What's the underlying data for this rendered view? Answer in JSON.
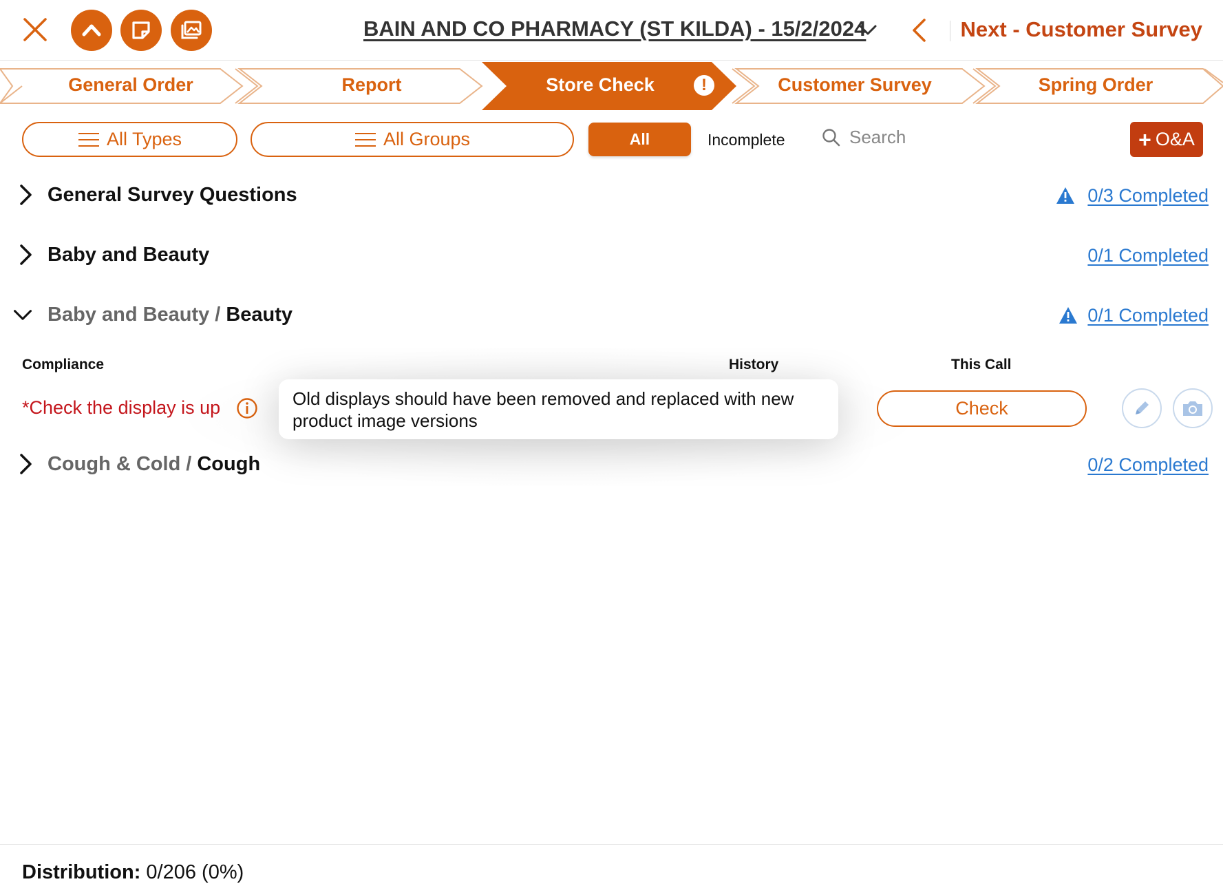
{
  "header": {
    "store_title": "BAIN AND CO PHARMACY (ST KILDA) - 15/2/2024",
    "next_label": "Next - Customer Survey",
    "icons": [
      "close-icon",
      "chevron-up-icon",
      "note-icon",
      "gallery-icon",
      "chevron-down-icon",
      "chevron-left-icon"
    ]
  },
  "steps": [
    {
      "label": "General Order",
      "active": false
    },
    {
      "label": "Report",
      "active": false
    },
    {
      "label": "Store Check",
      "active": true,
      "alert": "!"
    },
    {
      "label": "Customer Survey",
      "active": false
    },
    {
      "label": "Spring Order",
      "active": false
    }
  ],
  "filters": {
    "types": "All Types",
    "groups": "All Groups",
    "all": "All",
    "incomplete": "Incomplete",
    "search_placeholder": "Search",
    "qa_label": "O&A"
  },
  "sections": [
    {
      "title": "General Survey Questions",
      "completed": "0/3 Completed",
      "warning": true,
      "expanded": false
    },
    {
      "title": "Baby and Beauty",
      "completed": "0/1 Completed",
      "warning": false,
      "expanded": false
    },
    {
      "crumb": "Baby and Beauty",
      "separator": "/",
      "title": "Beauty",
      "completed": "0/1 Completed",
      "warning": true,
      "expanded": true
    },
    {
      "crumb": "Cough & Cold",
      "separator": "/",
      "title": "Cough",
      "completed": "0/2 Completed",
      "warning": false,
      "expanded": false
    }
  ],
  "compliance": {
    "col_compliance": "Compliance",
    "col_history": "History",
    "col_this_call": "This Call",
    "question": "*Check the display is up",
    "tooltip": "Old displays should have been removed and replaced with new product image versions",
    "check_label": "Check"
  },
  "footer": {
    "label": "Distribution:",
    "value": "0/206 (0%)"
  },
  "colors": {
    "accent": "#d9620f",
    "accent_dark": "#c23d10",
    "link": "#2a79d0",
    "required": "#c4161c"
  }
}
